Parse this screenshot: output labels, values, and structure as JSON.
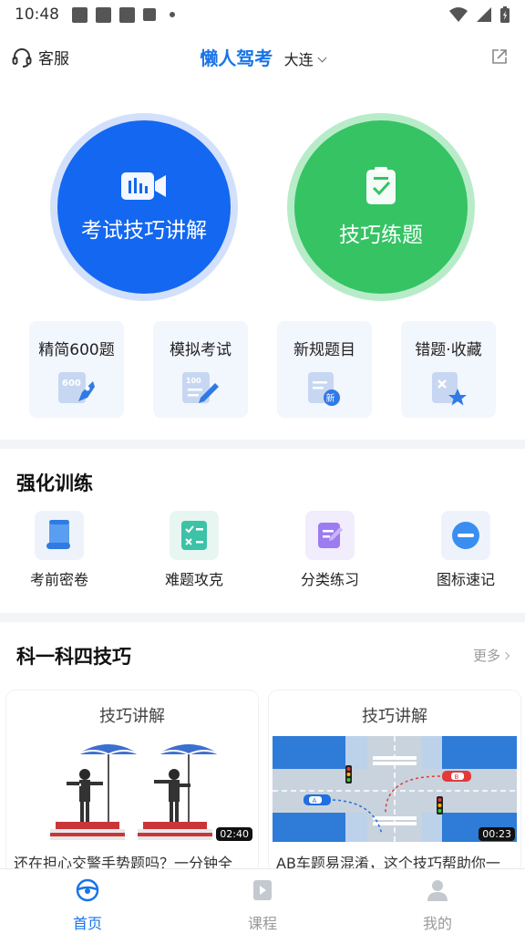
{
  "status_bar": {
    "time": "10:48"
  },
  "header": {
    "service_label": "客服",
    "app_title": "懒人驾考",
    "city": "大连"
  },
  "hero": {
    "left_button": {
      "label": "考试技巧讲解",
      "color": "#1367f0",
      "icon": "video-camera-icon"
    },
    "right_button": {
      "label": "技巧练题",
      "color": "#35c364",
      "icon": "checklist-icon"
    }
  },
  "quick_tiles": [
    {
      "label": "精简600题",
      "icon": "rocket-600-icon"
    },
    {
      "label": "模拟考试",
      "icon": "exam-pencil-icon"
    },
    {
      "label": "新规题目",
      "icon": "new-rule-doc-icon"
    },
    {
      "label": "错题·收藏",
      "icon": "wrong-star-icon"
    }
  ],
  "training": {
    "title": "强化训练",
    "items": [
      {
        "label": "考前密卷",
        "icon": "scroll-icon"
      },
      {
        "label": "难题攻克",
        "icon": "check-cross-list-icon"
      },
      {
        "label": "分类练习",
        "icon": "edit-doc-icon"
      },
      {
        "label": "图标速记",
        "icon": "minus-circle-icon"
      }
    ]
  },
  "tips": {
    "title": "科一科四技巧",
    "more_label": "更多",
    "videos": [
      {
        "title": "技巧讲解",
        "duration": "02:40",
        "desc": "还在担心交警手势题吗？一分钟全"
      },
      {
        "title": "技巧讲解",
        "duration": "00:23",
        "desc": "AB车题易混淆，这个技巧帮助你一"
      }
    ],
    "car_labels": [
      "A",
      "B"
    ]
  },
  "tabbar": {
    "tabs": [
      {
        "label": "首页",
        "icon": "steering-wheel-icon",
        "active": true
      },
      {
        "label": "课程",
        "icon": "course-play-icon",
        "active": false
      },
      {
        "label": "我的",
        "icon": "user-icon",
        "active": false
      }
    ],
    "accent": "#1a74e8"
  }
}
